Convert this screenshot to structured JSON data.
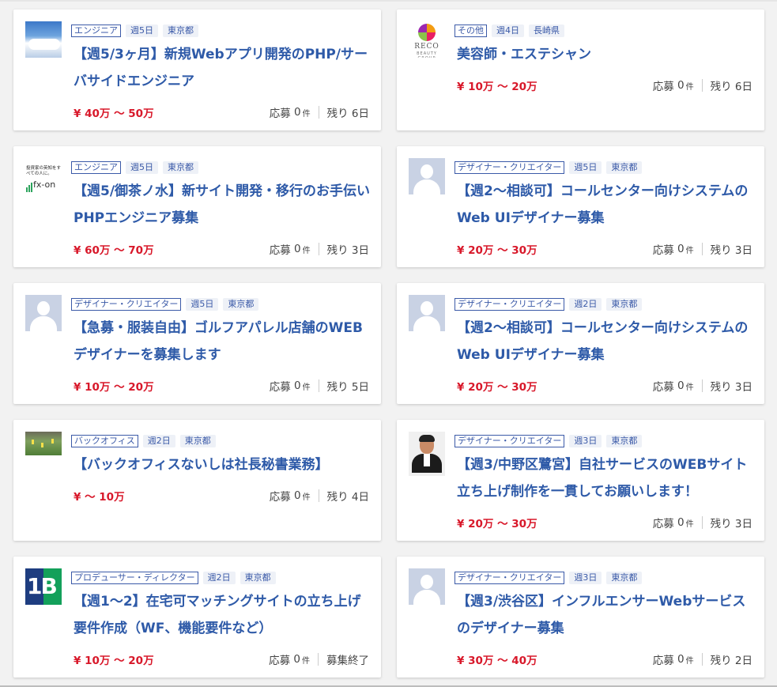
{
  "jobs": [
    {
      "category": "エンジニア",
      "days": "週5日",
      "location": "東京都",
      "title": "【週5/3ヶ月】新規Webアプリ開発のPHP/サーバサイドエンジニア",
      "price": "¥ 40万 〜 50万",
      "applicants_label": "応募",
      "applicants": "0",
      "unit": "件",
      "remaining": "残り 6日",
      "thumbnail": "sky-photo"
    },
    {
      "category": "その他",
      "days": "週4日",
      "location": "長崎県",
      "title": "美容師・エステシャン",
      "price": "¥ 10万 〜 20万",
      "applicants_label": "応募",
      "applicants": "0",
      "unit": "件",
      "remaining": "残り 6日",
      "thumbnail": "reco-beauty-logo",
      "logo_text": "RECO",
      "logo_sub": "BEAUTY GROUP"
    },
    {
      "category": "エンジニア",
      "days": "週5日",
      "location": "東京都",
      "title": "【週5/御茶ノ水】新サイト開発・移行のお手伝いPHPエンジニア募集",
      "price": "¥ 60万 〜 70万",
      "applicants_label": "応募",
      "applicants": "0",
      "unit": "件",
      "remaining": "残り 3日",
      "thumbnail": "fx-on-logo",
      "logo_text": "fx-on",
      "logo_sub": "投資家の英知をすべての人に。"
    },
    {
      "category": "デザイナー・クリエイター",
      "days": "週5日",
      "location": "東京都",
      "title": "【週2〜相談可】コールセンター向けシステムのWeb UIデザイナー募集",
      "price": "¥ 20万 〜 30万",
      "applicants_label": "応募",
      "applicants": "0",
      "unit": "件",
      "remaining": "残り 3日",
      "thumbnail": "default-avatar"
    },
    {
      "category": "デザイナー・クリエイター",
      "days": "週5日",
      "location": "東京都",
      "title": "【急募・服装自由】ゴルフアパレル店舗のWEBデザイナーを募集します",
      "price": "¥ 10万 〜 20万",
      "applicants_label": "応募",
      "applicants": "0",
      "unit": "件",
      "remaining": "残り 5日",
      "thumbnail": "default-avatar"
    },
    {
      "category": "デザイナー・クリエイター",
      "days": "週2日",
      "location": "東京都",
      "title": "【週2〜相談可】コールセンター向けシステムのWeb UIデザイナー募集",
      "price": "¥ 20万 〜 30万",
      "applicants_label": "応募",
      "applicants": "0",
      "unit": "件",
      "remaining": "残り 3日",
      "thumbnail": "default-avatar"
    },
    {
      "category": "バックオフィス",
      "days": "週2日",
      "location": "東京都",
      "title": "【バックオフィスないしは社長秘書業務】",
      "price": "¥ 〜 10万",
      "applicants_label": "応募",
      "applicants": "0",
      "unit": "件",
      "remaining": "残り 4日",
      "thumbnail": "soccer-photo"
    },
    {
      "category": "デザイナー・クリエイター",
      "days": "週3日",
      "location": "東京都",
      "title": "【週3/中野区鷺宮】自社サービスのWEBサイト立ち上げ制作を一貫してお願いします！",
      "price": "¥ 20万 〜 30万",
      "applicants_label": "応募",
      "applicants": "0",
      "unit": "件",
      "remaining": "残り 3日",
      "thumbnail": "person-photo"
    },
    {
      "category": "プロデューサー・ディレクター",
      "days": "週2日",
      "location": "東京都",
      "title": "【週1〜2】在宅可マッチングサイトの立ち上げ要件作成（WF、機能要件など）",
      "price": "¥ 10万 〜 20万",
      "applicants_label": "応募",
      "applicants": "0",
      "unit": "件",
      "remaining": "募集終了",
      "thumbnail": "1b-logo",
      "logo_text": "1B"
    },
    {
      "category": "デザイナー・クリエイター",
      "days": "週3日",
      "location": "東京都",
      "title": "【週3/渋谷区】インフルエンサーWebサービスのデザイナー募集",
      "price": "¥ 30万 〜 40万",
      "applicants_label": "応募",
      "applicants": "0",
      "unit": "件",
      "remaining": "残り 2日",
      "thumbnail": "default-avatar"
    }
  ]
}
